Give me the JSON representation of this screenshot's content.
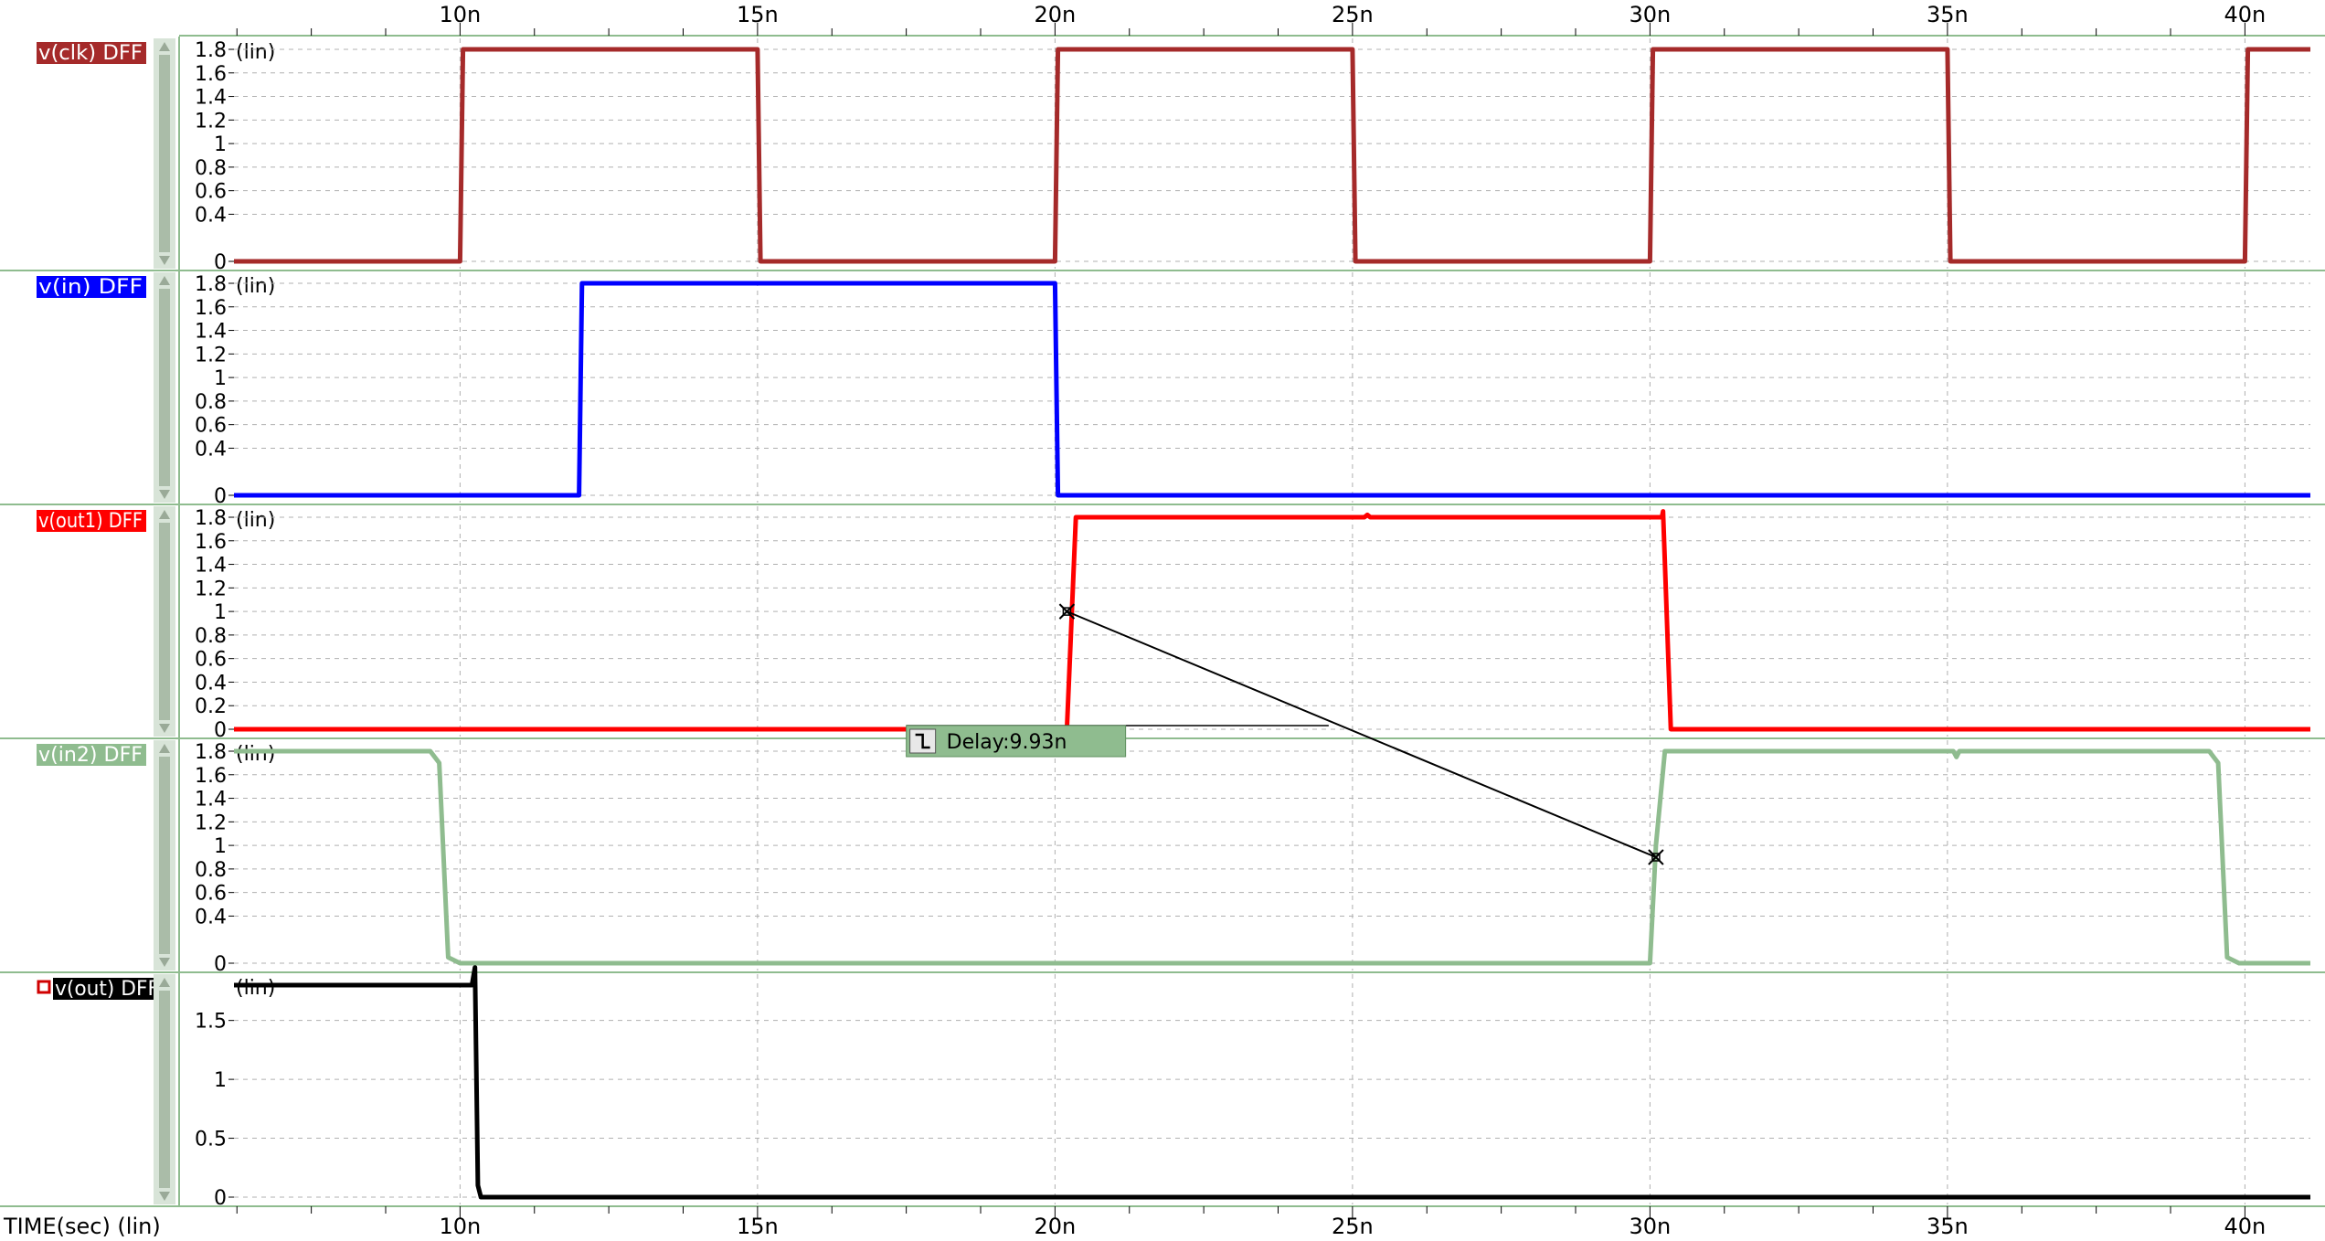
{
  "x_axis": {
    "label": "TIME(sec) (lin)",
    "ticks": [
      "10n",
      "15n",
      "20n",
      "25n",
      "30n",
      "35n",
      "40n"
    ],
    "tick_values_ns": [
      10,
      15,
      20,
      25,
      30,
      35,
      40
    ],
    "range_ns": [
      6.2,
      41.1
    ]
  },
  "measurement": {
    "label": "Delay:9.93n",
    "value_ns": 9.93,
    "start": {
      "panel": "out1",
      "t_ns": 20.2,
      "v": 1.0
    },
    "end": {
      "panel": "in2",
      "t_ns": 30.1,
      "v": 0.9
    }
  },
  "chart_data": [
    {
      "id": "clk",
      "type": "line",
      "title": "v(clk) DFF",
      "scale_label": "(lin)",
      "color": "#a52a2a",
      "ylim": [
        0,
        1.8
      ],
      "yticks": [
        "0",
        "0.4",
        "0.6",
        "0.8",
        "1",
        "1.2",
        "1.4",
        "1.6",
        "1.8"
      ],
      "ytick_values": [
        0,
        0.4,
        0.6,
        0.8,
        1,
        1.2,
        1.4,
        1.6,
        1.8
      ],
      "x_ns": [
        6.2,
        10.0,
        10.05,
        15.0,
        15.05,
        20.0,
        20.05,
        25.0,
        25.05,
        30.0,
        30.05,
        35.0,
        35.05,
        40.0,
        40.05,
        41.1
      ],
      "y": [
        0,
        0,
        1.8,
        1.8,
        0,
        0,
        1.8,
        1.8,
        0,
        0,
        1.8,
        1.8,
        0,
        0,
        1.8,
        1.8
      ]
    },
    {
      "id": "in",
      "type": "line",
      "title": "v(in) DFF",
      "scale_label": "(lin)",
      "color": "#0000ff",
      "ylim": [
        0,
        1.8
      ],
      "yticks": [
        "0",
        "0.4",
        "0.6",
        "0.8",
        "1",
        "1.2",
        "1.4",
        "1.6",
        "1.8"
      ],
      "ytick_values": [
        0,
        0.4,
        0.6,
        0.8,
        1,
        1.2,
        1.4,
        1.6,
        1.8
      ],
      "x_ns": [
        6.2,
        12.0,
        12.05,
        20.0,
        20.05,
        41.1
      ],
      "y": [
        0,
        0,
        1.8,
        1.8,
        0,
        0
      ]
    },
    {
      "id": "out1",
      "type": "line",
      "title": "v(out1) DFF",
      "scale_label": "(lin)",
      "color": "#ff0000",
      "ylim": [
        0,
        1.8
      ],
      "yticks": [
        "0",
        "0.2",
        "0.4",
        "0.6",
        "0.8",
        "1",
        "1.2",
        "1.4",
        "1.6",
        "1.8"
      ],
      "ytick_values": [
        0,
        0.2,
        0.4,
        0.6,
        0.8,
        1,
        1.2,
        1.4,
        1.6,
        1.8
      ],
      "x_ns": [
        6.2,
        20.2,
        20.35,
        25.2,
        25.25,
        25.3,
        30.2,
        30.22,
        30.35,
        41.1
      ],
      "y": [
        0,
        0,
        1.8,
        1.8,
        1.82,
        1.8,
        1.8,
        1.85,
        0,
        0
      ]
    },
    {
      "id": "in2",
      "type": "line",
      "title": "v(in2) DFF",
      "scale_label": "(lin)",
      "color": "#8fbc8f",
      "ylim": [
        0,
        1.8
      ],
      "yticks": [
        "0",
        "0.4",
        "0.6",
        "0.8",
        "1",
        "1.2",
        "1.4",
        "1.6",
        "1.8"
      ],
      "ytick_values": [
        0,
        0.4,
        0.6,
        0.8,
        1,
        1.2,
        1.4,
        1.6,
        1.8
      ],
      "x_ns": [
        6.2,
        9.5,
        9.65,
        9.8,
        10.0,
        30.0,
        30.1,
        30.25,
        35.1,
        35.15,
        35.2,
        39.4,
        39.55,
        39.7,
        39.9,
        41.1
      ],
      "y": [
        1.8,
        1.8,
        1.7,
        0.05,
        0,
        0,
        1.0,
        1.8,
        1.8,
        1.75,
        1.8,
        1.8,
        1.7,
        0.05,
        0,
        0
      ]
    },
    {
      "id": "out",
      "type": "line",
      "title": "v(out) DFF",
      "scale_label": "(lin)",
      "color": "#000000",
      "ylim": [
        0,
        1.8
      ],
      "yticks": [
        "0",
        "0.5",
        "1",
        "1.5"
      ],
      "ytick_values": [
        0,
        0.5,
        1,
        1.5
      ],
      "x_ns": [
        6.2,
        10.2,
        10.25,
        10.3,
        10.35,
        41.1
      ],
      "y": [
        1.8,
        1.8,
        1.95,
        0.1,
        0,
        0
      ]
    }
  ]
}
